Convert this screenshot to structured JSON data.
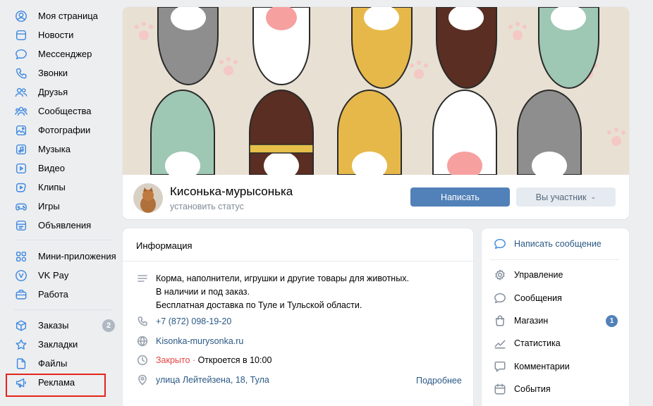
{
  "sidebar": {
    "items": [
      {
        "label": "Моя страница",
        "icon": "user-circle-icon"
      },
      {
        "label": "Новости",
        "icon": "news-icon"
      },
      {
        "label": "Мессенджер",
        "icon": "message-icon"
      },
      {
        "label": "Звонки",
        "icon": "phone-icon"
      },
      {
        "label": "Друзья",
        "icon": "friends-icon"
      },
      {
        "label": "Сообщества",
        "icon": "communities-icon"
      },
      {
        "label": "Фотографии",
        "icon": "photo-icon"
      },
      {
        "label": "Музыка",
        "icon": "music-icon"
      },
      {
        "label": "Видео",
        "icon": "video-icon"
      },
      {
        "label": "Клипы",
        "icon": "clips-icon"
      },
      {
        "label": "Игры",
        "icon": "gamepad-icon"
      },
      {
        "label": "Объявления",
        "icon": "ads-board-icon"
      },
      {
        "label": "Мини-приложения",
        "icon": "apps-icon"
      },
      {
        "label": "VK Pay",
        "icon": "vkpay-icon"
      },
      {
        "label": "Работа",
        "icon": "briefcase-icon"
      },
      {
        "label": "Заказы",
        "icon": "box-icon",
        "badge": "2"
      },
      {
        "label": "Закладки",
        "icon": "star-icon"
      },
      {
        "label": "Файлы",
        "icon": "file-icon"
      },
      {
        "label": "Реклама",
        "icon": "megaphone-icon"
      }
    ]
  },
  "group": {
    "name": "Кисонька-мурысонька",
    "status_placeholder": "установить статус",
    "write_button": "Написать",
    "member_button": "Вы участник"
  },
  "info": {
    "title": "Информация",
    "description_lines": [
      "Корма, наполнители, игрушки и другие товары для животных.",
      "В наличии и под заказ.",
      "Бесплатная доставка по Туле и Тульской области."
    ],
    "phone": "+7 (872) 098-19-20",
    "website": "Kisonka-murysonka.ru",
    "hours_closed": "Закрыто",
    "hours_separator": " · ",
    "hours_opens": "Откроется в 10:00",
    "address": "улица Лейтейзена, 18, Тула",
    "more_link": "Подробнее"
  },
  "menu": {
    "write_message": "Написать сообщение",
    "items": [
      {
        "label": "Управление",
        "icon": "gear-icon"
      },
      {
        "label": "Сообщения",
        "icon": "message-icon"
      },
      {
        "label": "Магазин",
        "icon": "shopping-bag-icon",
        "badge": "1"
      },
      {
        "label": "Статистика",
        "icon": "chart-icon"
      },
      {
        "label": "Комментарии",
        "icon": "comment-icon"
      },
      {
        "label": "События",
        "icon": "events-icon"
      }
    ]
  },
  "colors": {
    "accent": "#3f8ae0",
    "button_primary": "#5181b8",
    "highlight_border": "#e3241b",
    "closed_red": "#e64646",
    "link": "#2a5885"
  }
}
